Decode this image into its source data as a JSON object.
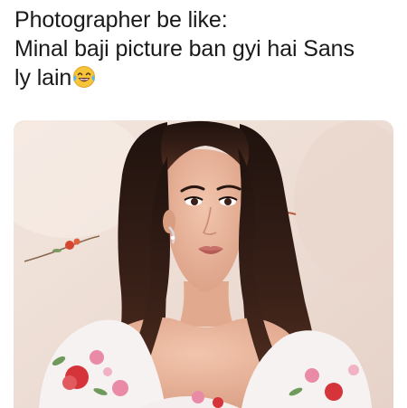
{
  "post": {
    "caption": {
      "line1": "Photographer be like:",
      "line2": "Minal baji picture ban gyi hai Sans",
      "line3": "ly lain"
    },
    "emoji": "face-with-tears-of-joy-icon"
  },
  "colors": {
    "text": "#1a1a1a",
    "background": "#ffffff",
    "photo_backdrop": "#ecdcd3",
    "hair": "#2a1712",
    "skin": "#e9b59a",
    "lips": "#c8706a",
    "dress": "#f7f2f2",
    "flower_red": "#d5343a",
    "flower_pink": "#e98aa6",
    "leaf_green": "#6f9a5c"
  }
}
